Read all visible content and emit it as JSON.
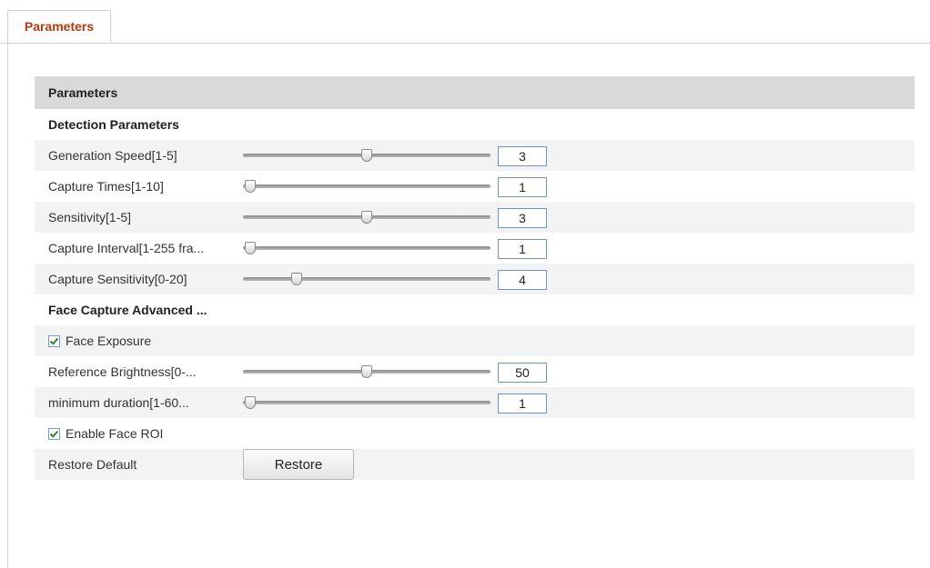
{
  "tab": {
    "label": "Parameters"
  },
  "panel": {
    "header": "Parameters",
    "detection_title": "Detection Parameters",
    "sliders": [
      {
        "label": "Generation Speed[1-5]",
        "value": "3",
        "min": 1,
        "max": 5
      },
      {
        "label": "Capture Times[1-10]",
        "value": "1",
        "min": 1,
        "max": 10
      },
      {
        "label": "Sensitivity[1-5]",
        "value": "3",
        "min": 1,
        "max": 5
      },
      {
        "label": "Capture Interval[1-255 fra...",
        "value": "1",
        "min": 1,
        "max": 255
      },
      {
        "label": "Capture Sensitivity[0-20]",
        "value": "4",
        "min": 0,
        "max": 20
      }
    ],
    "advanced_title": "Face Capture Advanced ...",
    "face_exposure": {
      "label": "Face Exposure",
      "checked": true
    },
    "advanced_sliders": [
      {
        "label": "Reference Brightness[0-...",
        "value": "50",
        "min": 0,
        "max": 100
      },
      {
        "label": "minimum duration[1-60...",
        "value": "1",
        "min": 1,
        "max": 60
      }
    ],
    "face_roi": {
      "label": "Enable Face ROI",
      "checked": true
    },
    "restore": {
      "label": "Restore Default",
      "button": "Restore"
    }
  },
  "colors": {
    "tab_text": "#b43a0d",
    "header_bg": "#d9d9d9",
    "row_alt": "#f3f3f3",
    "input_border": "#6f93c4"
  }
}
